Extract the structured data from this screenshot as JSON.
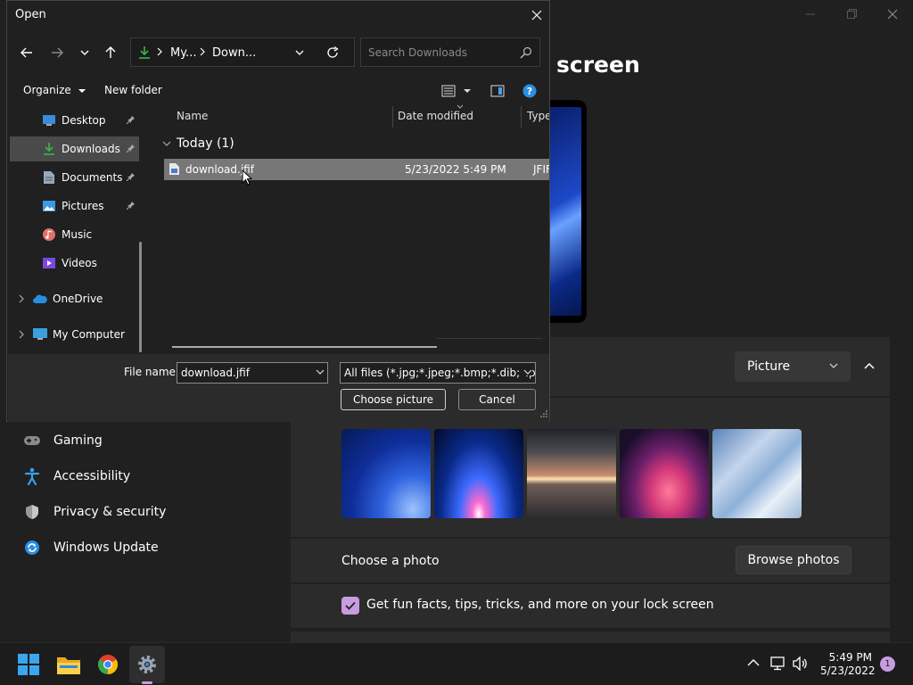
{
  "settings": {
    "page_heading": "screen",
    "sidebar": [
      {
        "label": "Gaming",
        "icon": "gamepad-icon"
      },
      {
        "label": "Accessibility",
        "icon": "accessibility-icon"
      },
      {
        "label": "Privacy & security",
        "icon": "shield-icon"
      },
      {
        "label": "Windows Update",
        "icon": "update-icon"
      }
    ],
    "background_type": "Picture",
    "choose_photo_label": "Choose a photo",
    "browse_photos_label": "Browse photos",
    "fun_facts_label": "Get fun facts, tips, tricks, and more on your lock screen",
    "fun_facts_checked": true,
    "accent_color": "#c79ce0"
  },
  "dialog": {
    "title": "Open",
    "breadcrumb": [
      "My...",
      "Down..."
    ],
    "search_placeholder": "Search Downloads",
    "organize_label": "Organize",
    "new_folder_label": "New folder",
    "tree": [
      {
        "label": "Desktop",
        "pinned": true
      },
      {
        "label": "Downloads",
        "pinned": true,
        "selected": true
      },
      {
        "label": "Documents",
        "pinned": true
      },
      {
        "label": "Pictures",
        "pinned": true
      },
      {
        "label": "Music"
      },
      {
        "label": "Videos"
      },
      {
        "label": "OneDrive"
      },
      {
        "label": "My Computer"
      }
    ],
    "columns": {
      "name": "Name",
      "date": "Date modified",
      "type": "Type"
    },
    "group_label": "Today (1)",
    "files": [
      {
        "name": "download.jfif",
        "date": "5/23/2022 5:49 PM",
        "type": "JFIF File"
      }
    ],
    "file_name_label": "File name:",
    "file_name_value": "download.jfif",
    "file_type_value": "All files (*.jpg;*.jpeg;*.bmp;*.dib;*.png",
    "choose_picture_label": "Choose picture",
    "cancel_label": "Cancel"
  },
  "taskbar": {
    "time": "5:49 PM",
    "date": "5/23/2022",
    "notifications": "1"
  }
}
